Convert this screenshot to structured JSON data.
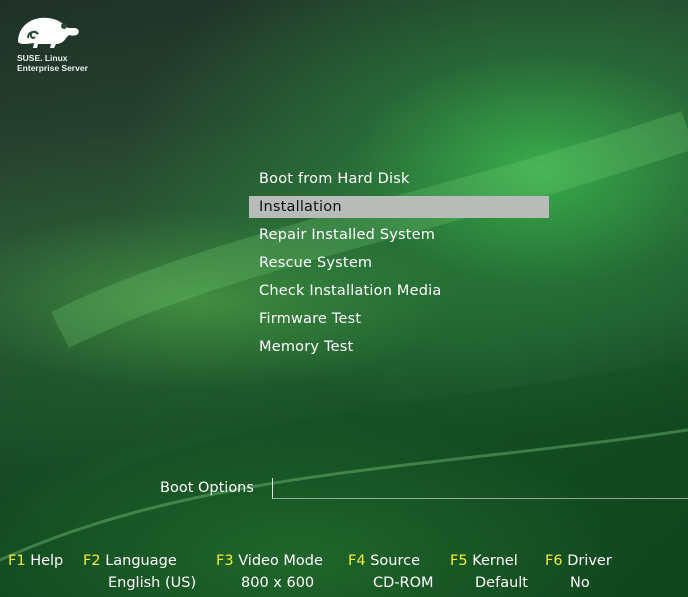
{
  "logo": {
    "line1": "SUSE. Linux",
    "line2": "Enterprise Server"
  },
  "menu": {
    "items": [
      {
        "label": "Boot from Hard Disk",
        "selected": false
      },
      {
        "label": "Installation",
        "selected": true
      },
      {
        "label": "Repair Installed System",
        "selected": false
      },
      {
        "label": "Rescue System",
        "selected": false
      },
      {
        "label": "Check Installation Media",
        "selected": false
      },
      {
        "label": "Firmware Test",
        "selected": false
      },
      {
        "label": "Memory Test",
        "selected": false
      }
    ]
  },
  "boot_options": {
    "label": "Boot Options",
    "value": ""
  },
  "fkeys": [
    {
      "key": "F1",
      "name": "Help",
      "value": ""
    },
    {
      "key": "F2",
      "name": "Language",
      "value": "English (US)"
    },
    {
      "key": "F3",
      "name": "Video Mode",
      "value": "800 x 600"
    },
    {
      "key": "F4",
      "name": "Source",
      "value": "CD-ROM"
    },
    {
      "key": "F5",
      "name": "Kernel",
      "value": "Default"
    },
    {
      "key": "F6",
      "name": "Driver",
      "value": "No"
    }
  ],
  "colors": {
    "fkey_accent": "#f0ec3a",
    "selection": "#b7bcb8"
  }
}
